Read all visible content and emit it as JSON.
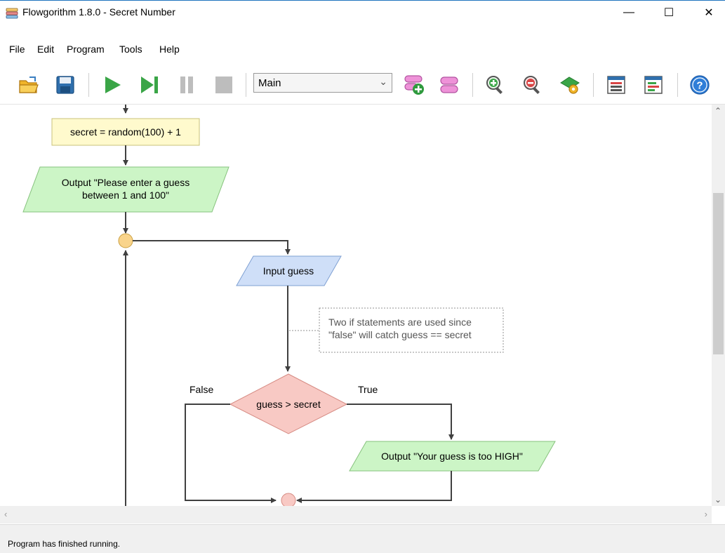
{
  "window": {
    "title": "Flowgorithm 1.8.0 - Secret Number",
    "minimize_glyph": "—",
    "maximize_glyph": "☐",
    "close_glyph": "✕"
  },
  "menu": [
    "File",
    "Edit",
    "Program",
    "Tools",
    "Help"
  ],
  "toolbar": {
    "function_select": "Main",
    "icons": [
      "open-folder-icon",
      "save-icon",
      "run-icon",
      "step-icon",
      "pause-icon",
      "stop-icon",
      "add-function-icon",
      "manage-functions-icon",
      "zoom-in-icon",
      "zoom-out-icon",
      "layout-settings-icon",
      "console-window-icon",
      "variable-watch-icon",
      "help-icon"
    ]
  },
  "flowchart": {
    "assign": "secret = random(100) + 1",
    "output1_line1": "Output \"Please enter a guess",
    "output1_line2": "between 1 and 100\"",
    "input": "Input guess",
    "comment_line1": "Two if statements are used since",
    "comment_line2": "\"false\" will catch guess == secret",
    "decision": "guess > secret",
    "false_label": "False",
    "true_label": "True",
    "output2": "Output \"Your guess is too HIGH\""
  },
  "colors": {
    "assign_fill": "#fffacd",
    "output_fill": "#ccf5c6",
    "input_fill": "#cfdff8",
    "decision_fill": "#f8c9c4",
    "loop_connector": "#f9d48b",
    "line": "#404040"
  },
  "status": "Program has finished running."
}
